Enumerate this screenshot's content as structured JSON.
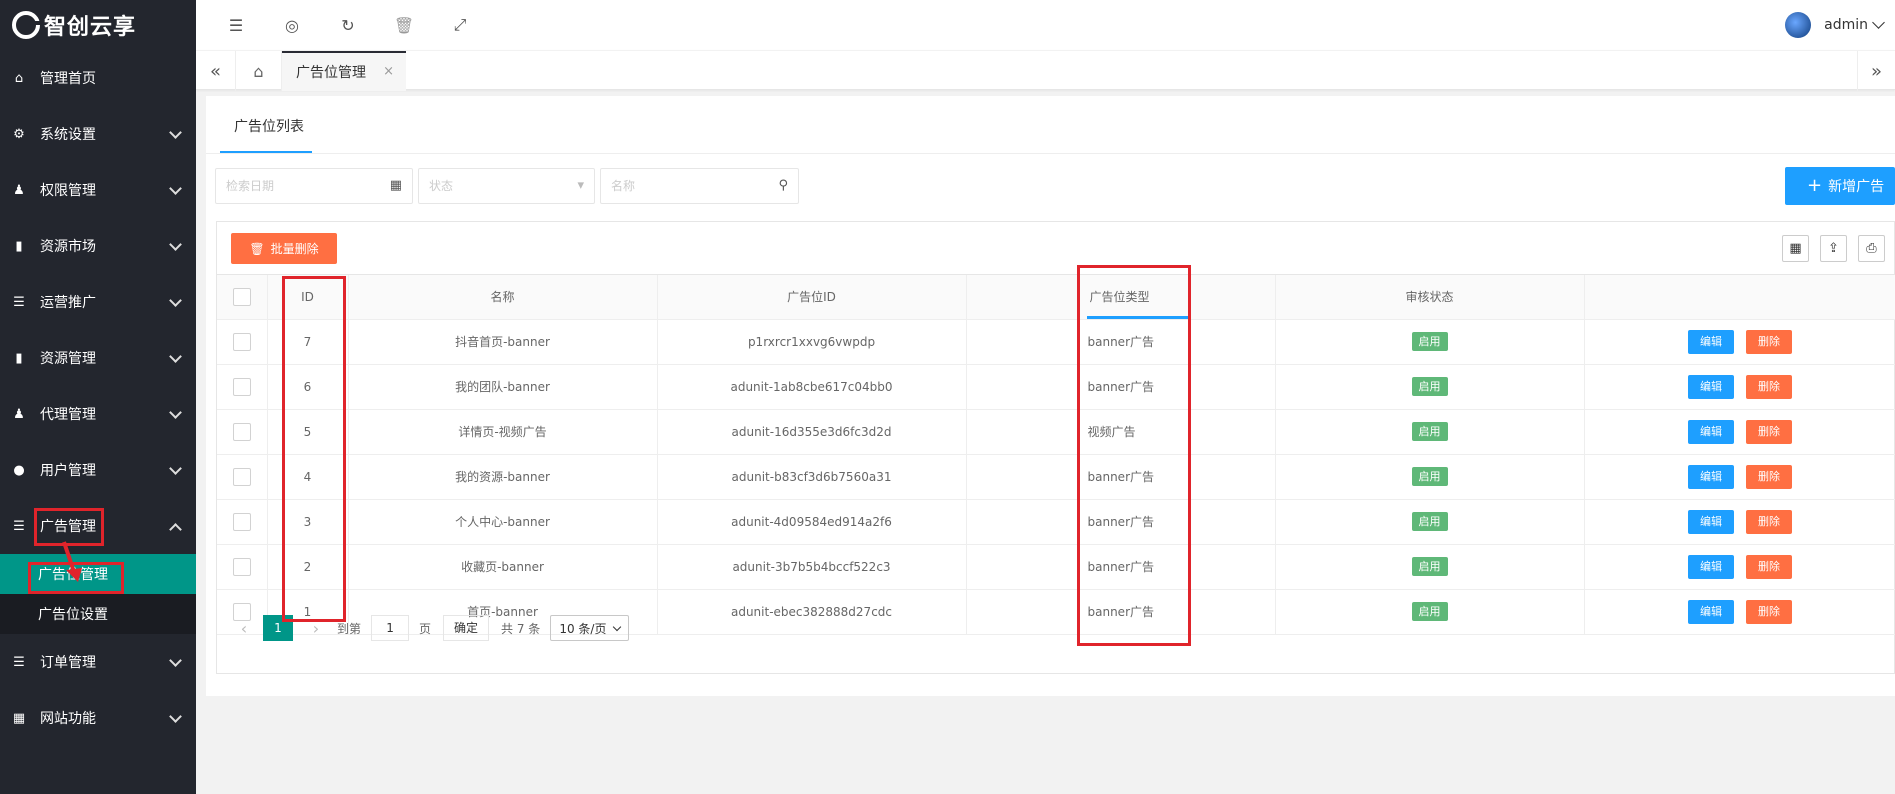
{
  "app": {
    "logo_text": "智创云享"
  },
  "sidebar": {
    "items": [
      {
        "label": "管理首页",
        "icon": "home-icon"
      },
      {
        "label": "系统设置",
        "icon": "gear-icon"
      },
      {
        "label": "权限管理",
        "icon": "user-group-icon"
      },
      {
        "label": "资源市场",
        "icon": "book-icon"
      },
      {
        "label": "运营推广",
        "icon": "list-icon"
      },
      {
        "label": "资源管理",
        "icon": "book-icon"
      },
      {
        "label": "代理管理",
        "icon": "users-icon"
      },
      {
        "label": "用户管理",
        "icon": "user-icon"
      },
      {
        "label": "广告管理",
        "icon": "list-icon"
      }
    ],
    "sub_items": [
      {
        "label": "广告位管理"
      },
      {
        "label": "广告位设置"
      }
    ],
    "items_after": [
      {
        "label": "订单管理",
        "icon": "list-icon"
      },
      {
        "label": "网站功能",
        "icon": "grid-icon"
      }
    ]
  },
  "header": {
    "username": "admin"
  },
  "tabs": {
    "active_label": "广告位管理",
    "close": "×"
  },
  "card": {
    "tab_label": "广告位列表"
  },
  "filters": {
    "date_placeholder": "检索日期",
    "status_placeholder": "状态",
    "name_placeholder": "名称"
  },
  "actions": {
    "add_label": "新增广告",
    "batch_delete_label": "批量删除"
  },
  "table": {
    "headers": [
      "ID",
      "名称",
      "广告位ID",
      "广告位类型",
      "审核状态"
    ],
    "rows": [
      {
        "id": "7",
        "name": "抖音首页-banner",
        "ad_id": "p1rxrcr1xxvg6vwpdp",
        "type": "banner广告",
        "status": "启用"
      },
      {
        "id": "6",
        "name": "我的团队-banner",
        "ad_id": "adunit-1ab8cbe617c04bb0",
        "type": "banner广告",
        "status": "启用"
      },
      {
        "id": "5",
        "name": "详情页-视频广告",
        "ad_id": "adunit-16d355e3d6fc3d2d",
        "type": "视频广告",
        "status": "启用"
      },
      {
        "id": "4",
        "name": "我的资源-banner",
        "ad_id": "adunit-b83cf3d6b7560a31",
        "type": "banner广告",
        "status": "启用"
      },
      {
        "id": "3",
        "name": "个人中心-banner",
        "ad_id": "adunit-4d09584ed914a2f6",
        "type": "banner广告",
        "status": "启用"
      },
      {
        "id": "2",
        "name": "收藏页-banner",
        "ad_id": "adunit-3b7b5b4bccf522c3",
        "type": "banner广告",
        "status": "启用"
      },
      {
        "id": "1",
        "name": "首页-banner",
        "ad_id": "adunit-ebec382888d27cdc",
        "type": "banner广告",
        "status": "启用"
      }
    ],
    "edit_label": "编辑",
    "delete_label": "删除"
  },
  "pager": {
    "current_page": "1",
    "goto_label": "到第",
    "goto_value": "1",
    "page_unit": "页",
    "confirm_label": "确定",
    "total_label": "共 7 条",
    "page_size": "10 条/页"
  },
  "colors": {
    "sidebar_bg": "#23262e",
    "active_green": "#009688",
    "primary_blue": "#1e9fff",
    "danger": "#ff5722",
    "success": "#5fb878",
    "highlight_red": "#e0242b"
  }
}
